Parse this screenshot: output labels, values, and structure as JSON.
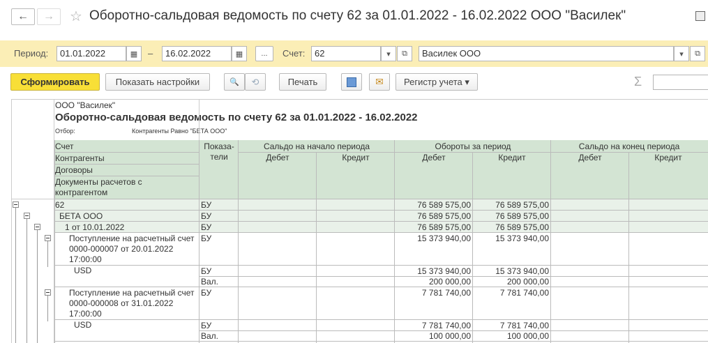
{
  "window": {
    "title": "Оборотно-сальдовая ведомость по счету 62 за 01.01.2022 - 16.02.2022 ООО \"Василек\""
  },
  "icons": {
    "back": "←",
    "forward": "→",
    "star": "☆",
    "calendar": "▦",
    "dropdown": "▾",
    "open": "⧉",
    "search": "🔍",
    "sigma": "Σ",
    "mail": "✉"
  },
  "filter": {
    "period_label": "Период:",
    "date_from": "01.01.2022",
    "dash": "–",
    "date_to": "16.02.2022",
    "dots": "...",
    "account_label": "Счет:",
    "account": "62",
    "org": "Василек ООО"
  },
  "toolbar": {
    "generate": "Сформировать",
    "settings": "Показать настройки",
    "print": "Печать",
    "register": "Регистр учета"
  },
  "report": {
    "org": "ООО \"Василек\"",
    "title": "Оборотно-сальдовая ведомость по счету 62 за 01.01.2022 - 16.02.2022",
    "filter_label": "Отбор:",
    "filter_value": "Контрагенты Равно \"БЕТА ООО\"",
    "h_account": "Счет",
    "h_counterparty": "Контрагенты",
    "h_contracts": "Договоры",
    "h_docs1": "Документы расчетов с",
    "h_docs2": "контрагентом",
    "h_indicators1": "Показа-",
    "h_indicators2": "тели",
    "h_open": "Сальдо на начало периода",
    "h_turn": "Обороты за период",
    "h_close": "Сальдо на конец периода",
    "debit": "Дебет",
    "credit": "Кредит",
    "rows": [
      {
        "name": "62",
        "ind": "БУ",
        "td": "76 589 575,00",
        "tc": "76 589 575,00"
      },
      {
        "name": "БЕТА ООО",
        "ind": "БУ",
        "td": "76 589 575,00",
        "tc": "76 589 575,00"
      },
      {
        "name": "1 от 10.01.2022",
        "ind": "БУ",
        "td": "76 589 575,00",
        "tc": "76 589 575,00"
      },
      {
        "name1": "Поступление на расчетный счет",
        "name2": "0000-000007 от 20.01.2022",
        "name3": "17:00:00",
        "ind": "БУ",
        "td": "15 373 940,00",
        "tc": "15 373 940,00"
      },
      {
        "name": "USD",
        "ind": "БУ",
        "td": "15 373 940,00",
        "tc": "15 373 940,00",
        "ind2": "Вал.",
        "td2": "200 000,00",
        "tc2": "200 000,00"
      },
      {
        "name1": "Поступление на расчетный счет",
        "name2": "0000-000008 от 31.01.2022",
        "name3": "17:00:00",
        "ind": "БУ",
        "td": "7 781 740,00",
        "tc": "7 781 740,00"
      },
      {
        "name": "USD",
        "ind": "БУ",
        "td": "7 781 740,00",
        "tc": "7 781 740,00",
        "ind2": "Вал.",
        "td2": "100 000,00",
        "tc2": "100 000,00"
      }
    ]
  }
}
